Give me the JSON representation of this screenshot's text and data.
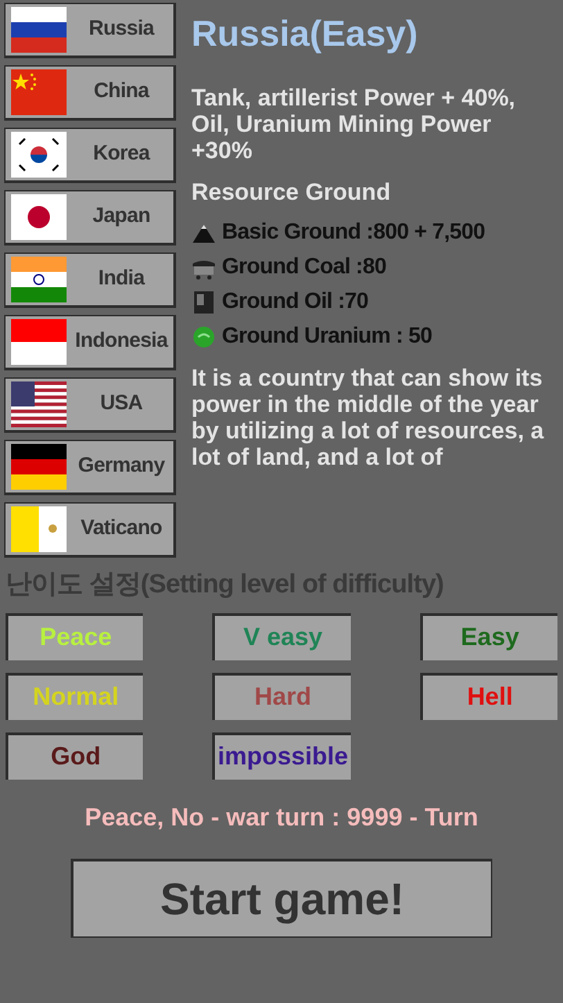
{
  "countries": [
    {
      "name": "Russia",
      "kind": "russia"
    },
    {
      "name": "China",
      "kind": "china"
    },
    {
      "name": "Korea",
      "kind": "korea"
    },
    {
      "name": "Japan",
      "kind": "japan"
    },
    {
      "name": "India",
      "kind": "india"
    },
    {
      "name": "Indonesia",
      "kind": "indonesia"
    },
    {
      "name": "USA",
      "kind": "usa"
    },
    {
      "name": "Germany",
      "kind": "germany"
    },
    {
      "name": "Vaticano",
      "kind": "vatican"
    }
  ],
  "detail": {
    "title": "Russia(Easy)",
    "bonus": "Tank, artillerist Power + 40%, Oil, Uranium Mining Power +30%",
    "resource_heading": "Resource Ground",
    "resources": [
      {
        "kind": "ground",
        "text": "Basic Ground :800 + 7,500"
      },
      {
        "kind": "coal",
        "text": "Ground Coal :80"
      },
      {
        "kind": "oil",
        "text": "Ground Oil :70"
      },
      {
        "kind": "uranium",
        "text": "Ground Uranium : 50"
      }
    ],
    "description": "It is a country that can show its power in the middle of the year by utilizing a lot of resources, a lot of land, and a lot of"
  },
  "difficulty": {
    "heading": "난이도 설정(Setting level of difficulty)",
    "levels": [
      {
        "label": "Peace",
        "color": "#b8f040"
      },
      {
        "label": "V easy",
        "color": "#1f8456"
      },
      {
        "label": "Easy",
        "color": "#1e6a1e"
      },
      {
        "label": "Normal",
        "color": "#d4d420"
      },
      {
        "label": "Hard",
        "color": "#a04848"
      },
      {
        "label": "Hell",
        "color": "#e01010"
      },
      {
        "label": "God",
        "color": "#5a1a1a"
      },
      {
        "label": "impossible",
        "color": "#3a1a90"
      }
    ]
  },
  "peace_info": "Peace, No - war turn : 9999 - Turn",
  "start_button": "Start game!"
}
